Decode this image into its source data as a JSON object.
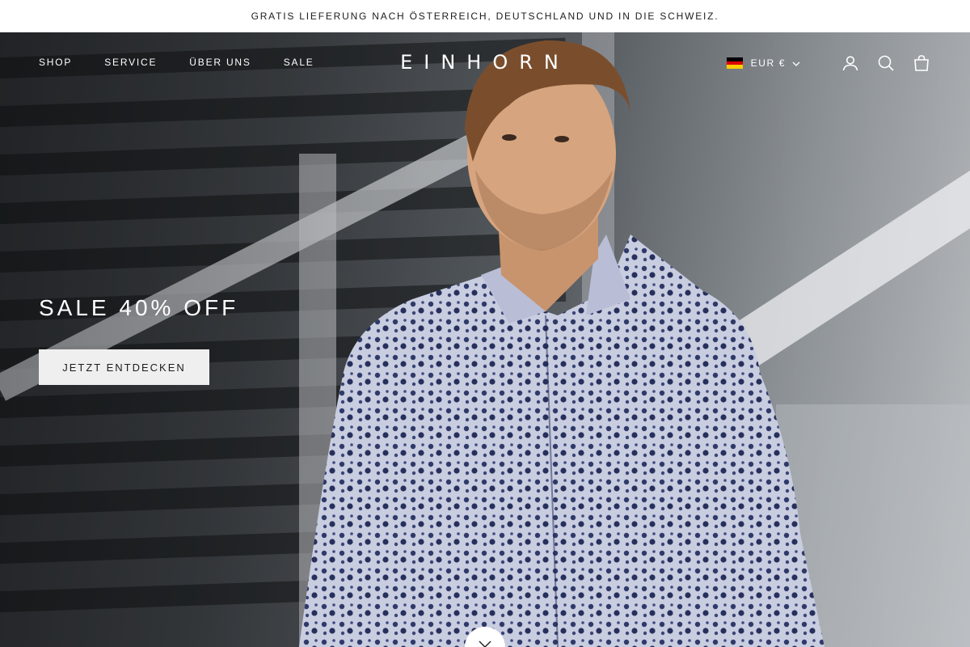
{
  "announcement": {
    "text": "GRATIS LIEFERUNG NACH ÖSTERREICH, DEUTSCHLAND UND IN DIE SCHWEIZ."
  },
  "header": {
    "nav": [
      {
        "label": "SHOP"
      },
      {
        "label": "SERVICE"
      },
      {
        "label": "ÜBER UNS"
      },
      {
        "label": "SALE"
      }
    ],
    "logo": "EINHORN",
    "currency": {
      "label": "EUR €",
      "flag": "germany-flag",
      "flag_colors": [
        "#000000",
        "#dd0000",
        "#ffce00"
      ]
    },
    "icons": [
      "account-icon",
      "search-icon",
      "cart-icon"
    ]
  },
  "hero": {
    "title": "SALE 40% OFF",
    "cta_label": "JETZT ENTDECKEN",
    "scroll_icon": "chevron-down-icon"
  },
  "colors": {
    "text_dark": "#1c1c1c",
    "cta_bg": "#efefef",
    "shirt_navy": "#2f3a6a"
  }
}
